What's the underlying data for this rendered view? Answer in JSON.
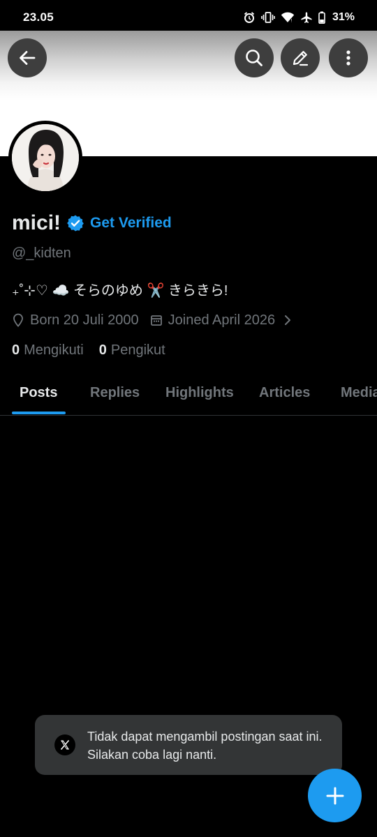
{
  "status_bar": {
    "time": "23.05",
    "battery_percent": "31%"
  },
  "profile": {
    "display_name": "mici!",
    "get_verified_label": "Get Verified",
    "handle": "@_kidten",
    "bio": "₊˚⊹♡ ☁️ そらのゆめ ✂️ きらきら!",
    "born": "Born 20 Juli 2000",
    "joined": "Joined April 2026",
    "following_count": "0",
    "following_label": "Mengikuti",
    "followers_count": "0",
    "followers_label": "Pengikut"
  },
  "tabs": [
    {
      "label": "Posts",
      "active": true
    },
    {
      "label": "Replies",
      "active": false
    },
    {
      "label": "Highlights",
      "active": false
    },
    {
      "label": "Articles",
      "active": false
    },
    {
      "label": "Media",
      "active": false
    }
  ],
  "toast": {
    "message": "Tidak dapat mengambil postingan saat ini. Silakan coba lagi nanti."
  },
  "icons": {
    "back": "arrow-left-icon",
    "search": "search-icon",
    "edit": "pencil-icon",
    "more": "more-vertical-icon",
    "location": "location-pin-icon",
    "calendar": "calendar-icon",
    "fab": "plus-icon",
    "toast": "x-logo-icon"
  },
  "colors": {
    "accent": "#1d9bf0",
    "background": "#000000",
    "muted_text": "#71767b",
    "toast_bg": "#333536"
  }
}
